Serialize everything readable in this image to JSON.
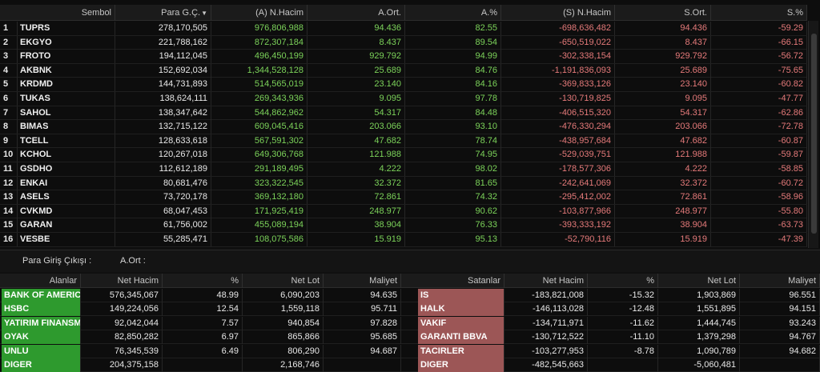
{
  "main_table": {
    "headers": {
      "symbol": "Sembol",
      "para": "Para G.Ç.",
      "a_hacim": "(A) N.Hacim",
      "a_ort": "A.Ort.",
      "a_pct": "A.%",
      "s_hacim": "(S) N.Hacim",
      "s_ort": "S.Ort.",
      "s_pct": "S.%"
    },
    "sort_indicator": "▼",
    "rows": [
      {
        "idx": "1",
        "symbol": "TUPRS",
        "para": "278,170,505",
        "a_hacim": "976,806,988",
        "a_ort": "94.436",
        "a_pct": "82.55",
        "s_hacim": "-698,636,482",
        "s_ort": "94.436",
        "s_pct": "-59.29"
      },
      {
        "idx": "2",
        "symbol": "EKGYO",
        "para": "221,788,162",
        "a_hacim": "872,307,184",
        "a_ort": "8.437",
        "a_pct": "89.54",
        "s_hacim": "-650,519,022",
        "s_ort": "8.437",
        "s_pct": "-66.15"
      },
      {
        "idx": "3",
        "symbol": "FROTO",
        "para": "194,112,045",
        "a_hacim": "496,450,199",
        "a_ort": "929.792",
        "a_pct": "94.99",
        "s_hacim": "-302,338,154",
        "s_ort": "929.792",
        "s_pct": "-56.72"
      },
      {
        "idx": "4",
        "symbol": "AKBNK",
        "para": "152,692,034",
        "a_hacim": "1,344,528,128",
        "a_ort": "25.689",
        "a_pct": "84.76",
        "s_hacim": "-1,191,836,093",
        "s_ort": "25.689",
        "s_pct": "-75.65"
      },
      {
        "idx": "5",
        "symbol": "KRDMD",
        "para": "144,731,893",
        "a_hacim": "514,565,019",
        "a_ort": "23.140",
        "a_pct": "84.16",
        "s_hacim": "-369,833,126",
        "s_ort": "23.140",
        "s_pct": "-60.82"
      },
      {
        "idx": "6",
        "symbol": "TUKAS",
        "para": "138,624,111",
        "a_hacim": "269,343,936",
        "a_ort": "9.095",
        "a_pct": "97.78",
        "s_hacim": "-130,719,825",
        "s_ort": "9.095",
        "s_pct": "-47.77"
      },
      {
        "idx": "7",
        "symbol": "SAHOL",
        "para": "138,347,642",
        "a_hacim": "544,862,962",
        "a_ort": "54.317",
        "a_pct": "84.48",
        "s_hacim": "-406,515,320",
        "s_ort": "54.317",
        "s_pct": "-62.86"
      },
      {
        "idx": "8",
        "symbol": "BIMAS",
        "para": "132,715,122",
        "a_hacim": "609,045,416",
        "a_ort": "203.066",
        "a_pct": "93.10",
        "s_hacim": "-476,330,294",
        "s_ort": "203.066",
        "s_pct": "-72.78"
      },
      {
        "idx": "9",
        "symbol": "TCELL",
        "para": "128,633,618",
        "a_hacim": "567,591,302",
        "a_ort": "47.682",
        "a_pct": "78.74",
        "s_hacim": "-438,957,684",
        "s_ort": "47.682",
        "s_pct": "-60.87"
      },
      {
        "idx": "10",
        "symbol": "KCHOL",
        "para": "120,267,018",
        "a_hacim": "649,306,768",
        "a_ort": "121.988",
        "a_pct": "74.95",
        "s_hacim": "-529,039,751",
        "s_ort": "121.988",
        "s_pct": "-59.87"
      },
      {
        "idx": "11",
        "symbol": "GSDHO",
        "para": "112,612,189",
        "a_hacim": "291,189,495",
        "a_ort": "4.222",
        "a_pct": "98.02",
        "s_hacim": "-178,577,306",
        "s_ort": "4.222",
        "s_pct": "-58.85"
      },
      {
        "idx": "12",
        "symbol": "ENKAI",
        "para": "80,681,476",
        "a_hacim": "323,322,545",
        "a_ort": "32.372",
        "a_pct": "81.65",
        "s_hacim": "-242,641,069",
        "s_ort": "32.372",
        "s_pct": "-60.72"
      },
      {
        "idx": "13",
        "symbol": "ASELS",
        "para": "73,720,178",
        "a_hacim": "369,132,180",
        "a_ort": "72.861",
        "a_pct": "74.32",
        "s_hacim": "-295,412,002",
        "s_ort": "72.861",
        "s_pct": "-58.96"
      },
      {
        "idx": "14",
        "symbol": "CVKMD",
        "para": "68,047,453",
        "a_hacim": "171,925,419",
        "a_ort": "248.977",
        "a_pct": "90.62",
        "s_hacim": "-103,877,966",
        "s_ort": "248.977",
        "s_pct": "-55.80"
      },
      {
        "idx": "15",
        "symbol": "GARAN",
        "para": "61,756,002",
        "a_hacim": "455,089,194",
        "a_ort": "38.904",
        "a_pct": "76.33",
        "s_hacim": "-393,333,192",
        "s_ort": "38.904",
        "s_pct": "-63.73"
      },
      {
        "idx": "16",
        "symbol": "VESBE",
        "para": "55,285,471",
        "a_hacim": "108,075,586",
        "a_ort": "15.919",
        "a_pct": "95.13",
        "s_hacim": "-52,790,116",
        "s_ort": "15.919",
        "s_pct": "-47.39"
      }
    ]
  },
  "info_bar": {
    "para_label": "Para Giriş Çıkışı :",
    "aort_label": "A.Ort :"
  },
  "buyers": {
    "headers": {
      "name": "Alanlar",
      "net_hacim": "Net Hacim",
      "pct": "%",
      "net_lot": "Net Lot",
      "maliyet": "Maliyet"
    },
    "rows": [
      {
        "name": "BANK OF AMERICA",
        "net_hacim": "576,345,067",
        "pct": "48.99",
        "net_lot": "6,090,203",
        "maliyet": "94.635"
      },
      {
        "name": "HSBC",
        "net_hacim": "149,224,056",
        "pct": "12.54",
        "net_lot": "1,559,118",
        "maliyet": "95.711"
      },
      {
        "name": "YATIRIM FINANSM",
        "net_hacim": "92,042,044",
        "pct": "7.57",
        "net_lot": "940,854",
        "maliyet": "97.828"
      },
      {
        "name": "OYAK",
        "net_hacim": "82,850,282",
        "pct": "6.97",
        "net_lot": "865,866",
        "maliyet": "95.685"
      },
      {
        "name": "UNLU",
        "net_hacim": "76,345,539",
        "pct": "6.49",
        "net_lot": "806,290",
        "maliyet": "94.687"
      },
      {
        "name": "DIGER",
        "net_hacim": "204,375,158",
        "pct": "",
        "net_lot": "2,168,746",
        "maliyet": ""
      }
    ]
  },
  "sellers": {
    "headers": {
      "name": "Satanlar",
      "net_hacim": "Net Hacim",
      "pct": "%",
      "net_lot": "Net Lot",
      "maliyet": "Maliyet"
    },
    "rows": [
      {
        "name": "IS",
        "net_hacim": "-183,821,008",
        "pct": "-15.32",
        "net_lot": "1,903,869",
        "maliyet": "96.551"
      },
      {
        "name": "HALK",
        "net_hacim": "-146,113,028",
        "pct": "-12.48",
        "net_lot": "1,551,895",
        "maliyet": "94.151"
      },
      {
        "name": "VAKIF",
        "net_hacim": "-134,711,971",
        "pct": "-11.62",
        "net_lot": "1,444,745",
        "maliyet": "93.243"
      },
      {
        "name": "GARANTI BBVA",
        "net_hacim": "-130,712,522",
        "pct": "-11.10",
        "net_lot": "1,379,298",
        "maliyet": "94.767"
      },
      {
        "name": "TACIRLER",
        "net_hacim": "-103,277,953",
        "pct": "-8.78",
        "net_lot": "1,090,789",
        "maliyet": "94.682"
      },
      {
        "name": "DIGER",
        "net_hacim": "-482,545,663",
        "pct": "",
        "net_lot": "-5,060,481",
        "maliyet": ""
      }
    ]
  }
}
